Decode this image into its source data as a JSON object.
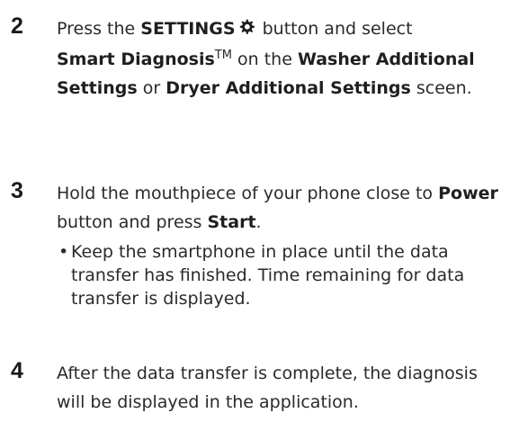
{
  "steps": [
    {
      "number": "2",
      "text": {
        "a": "Press the ",
        "b": "SETTINGS",
        "c": " button and select",
        "d": "Smart Diagnosis",
        "tm": "TM",
        "e": " on the ",
        "f": "Washer Additional Settings",
        "g": " or ",
        "h": "Dryer Additional Settings",
        "i": " sceen."
      },
      "icon": "gear-icon"
    },
    {
      "number": "3",
      "text": {
        "a": "Hold the mouthpiece of your phone close to ",
        "b": "Power",
        "c": " button and press ",
        "d": "Start",
        "e": "."
      },
      "bullet": {
        "symbol": "•",
        "text": "Keep the smartphone in place until the data transfer has finished. Time remaining for data transfer is displayed."
      }
    },
    {
      "number": "4",
      "text": {
        "a": "After the data transfer is complete, the diagnosis will be displayed in the application."
      }
    }
  ]
}
